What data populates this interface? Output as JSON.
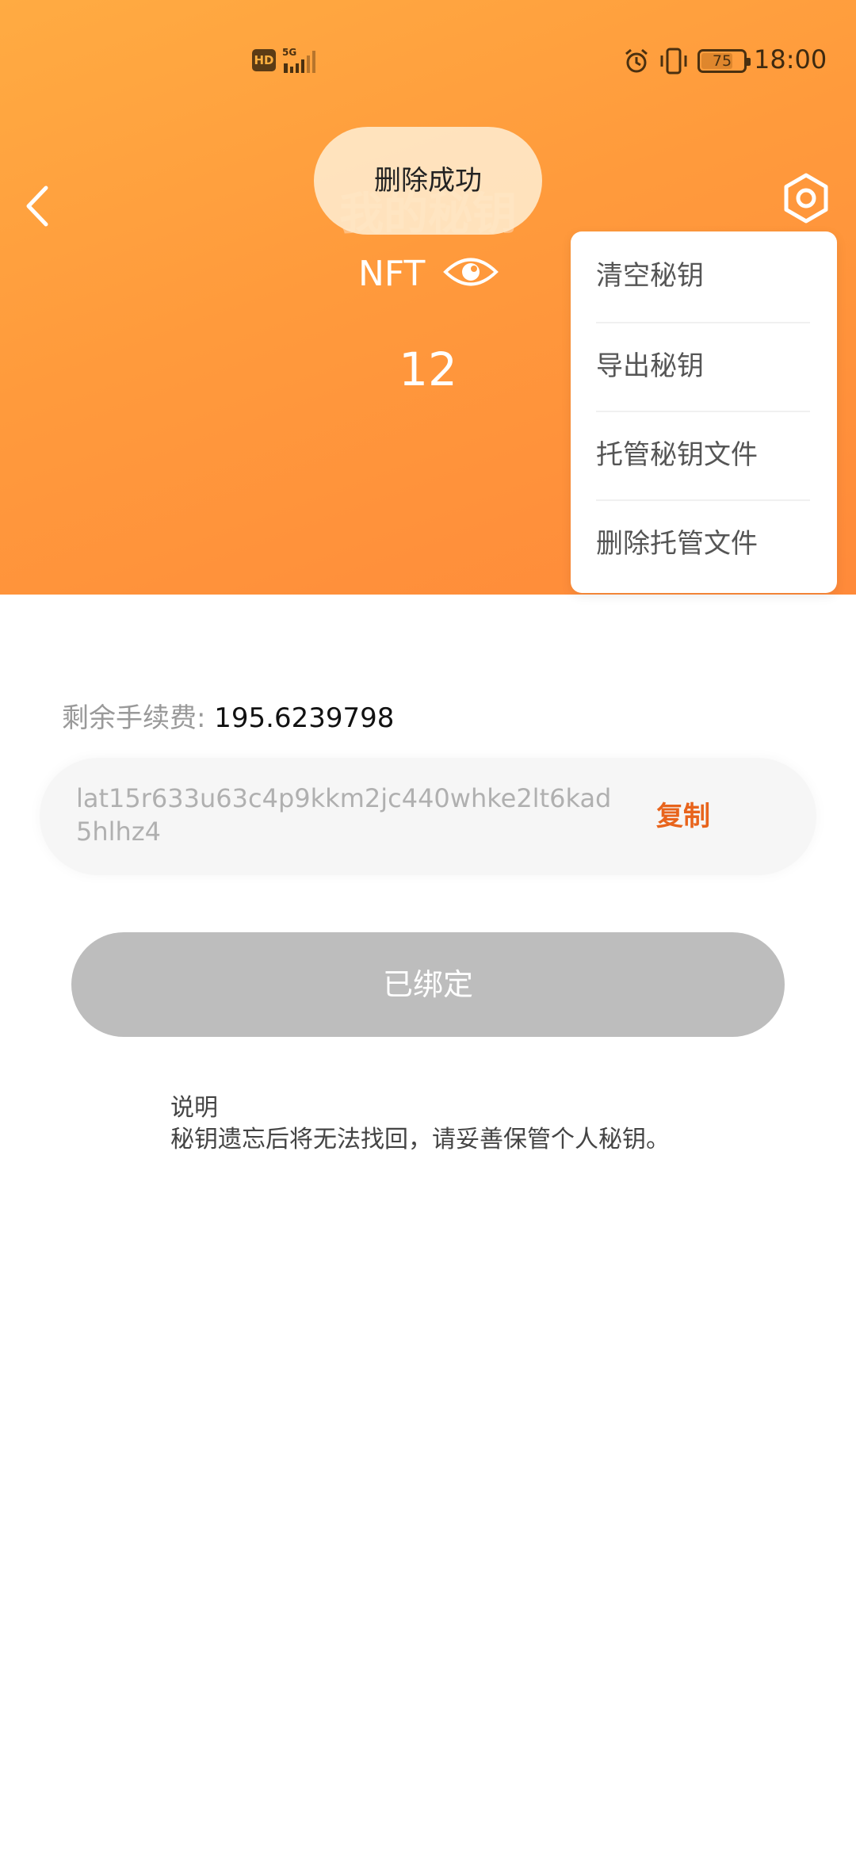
{
  "status_bar": {
    "hd": "HD",
    "network": "5G",
    "battery": "75",
    "battery_level": 0.75,
    "time": "18:00"
  },
  "header": {
    "title": "我的秘钥",
    "nft_label": "NFT",
    "nft_count": "12",
    "gradient_start": "#ffab42",
    "gradient_end": "#ff8a3a"
  },
  "toast": {
    "message": "删除成功"
  },
  "menu": {
    "items": [
      {
        "label": "清空秘钥"
      },
      {
        "label": "导出秘钥"
      },
      {
        "label": "托管秘钥文件"
      },
      {
        "label": "删除托管文件"
      }
    ]
  },
  "fee": {
    "label": "剩余手续费:",
    "value": "195.6239798"
  },
  "address": {
    "value": "lat15r633u63c4p9kkm2jc440whke2lt6kad5hlhz4",
    "copy_label": "复制",
    "copy_color": "#e8641c"
  },
  "bind_button": {
    "label": "已绑定"
  },
  "note": {
    "title": "说明",
    "text": "秘钥遗忘后将无法找回，请妥善保管个人秘钥。"
  },
  "icons": [
    "back-icon",
    "gear-icon",
    "eye-icon",
    "alarm-icon",
    "vibrate-icon",
    "signal-icon"
  ]
}
